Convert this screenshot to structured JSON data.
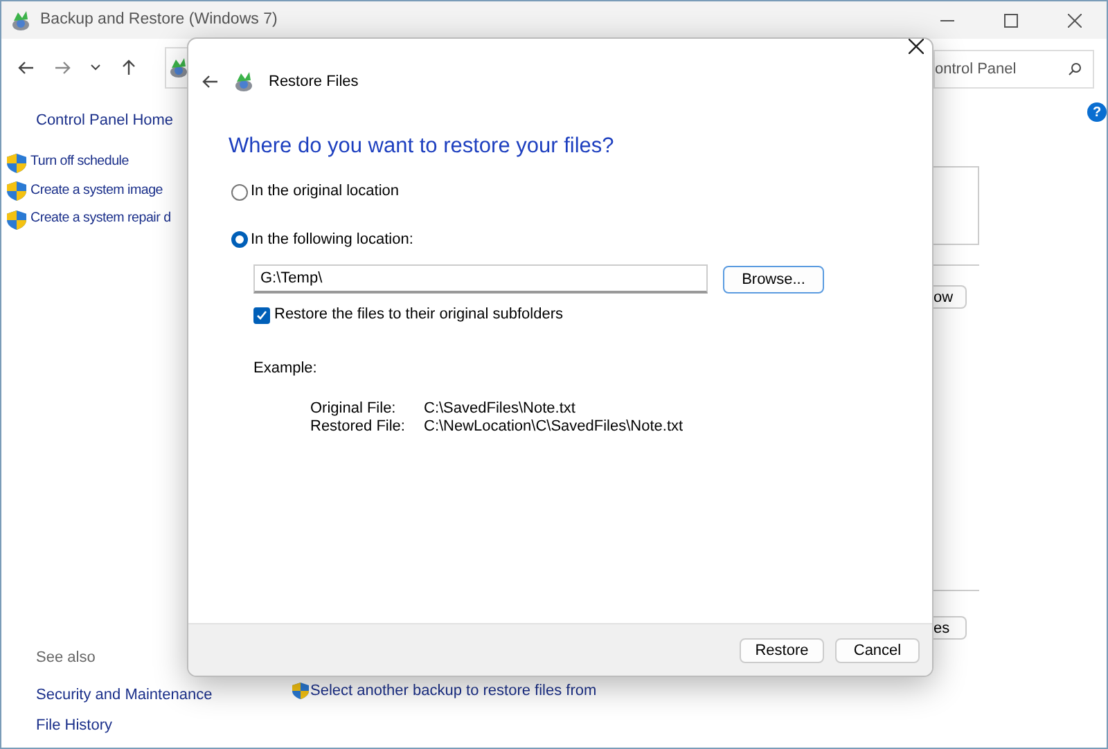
{
  "window": {
    "title": "Backup and Restore (Windows 7)"
  },
  "search": {
    "placeholder": "ontrol Panel"
  },
  "help": "?",
  "sidebar": {
    "home": "Control Panel Home",
    "tasks": [
      "Turn off schedule",
      "Create a system image",
      "Create a system repair d"
    ],
    "see_also_heading": "See also",
    "see_also": [
      "Security and Maintenance",
      "File History"
    ]
  },
  "background": {
    "button_1": "ow",
    "button_2": "es",
    "link": "Select another backup to restore files from"
  },
  "dialog": {
    "title": "Restore Files",
    "heading": "Where do you want to restore your files?",
    "options": [
      {
        "label": "In the original location",
        "selected": false
      },
      {
        "label": "In the following location:",
        "selected": true
      }
    ],
    "path": {
      "value": "G:\\Temp\\"
    },
    "browse": "Browse...",
    "subfolders": {
      "label": "Restore the files to their original subfolders",
      "checked": true
    },
    "example_label": "Example:",
    "example_rows": [
      {
        "label": "Original File:",
        "value": "C:\\SavedFiles\\Note.txt"
      },
      {
        "label": "Restored File:",
        "value": "C:\\NewLocation\\C\\SavedFiles\\Note.txt"
      }
    ],
    "buttons": [
      "Restore",
      "Cancel"
    ]
  }
}
